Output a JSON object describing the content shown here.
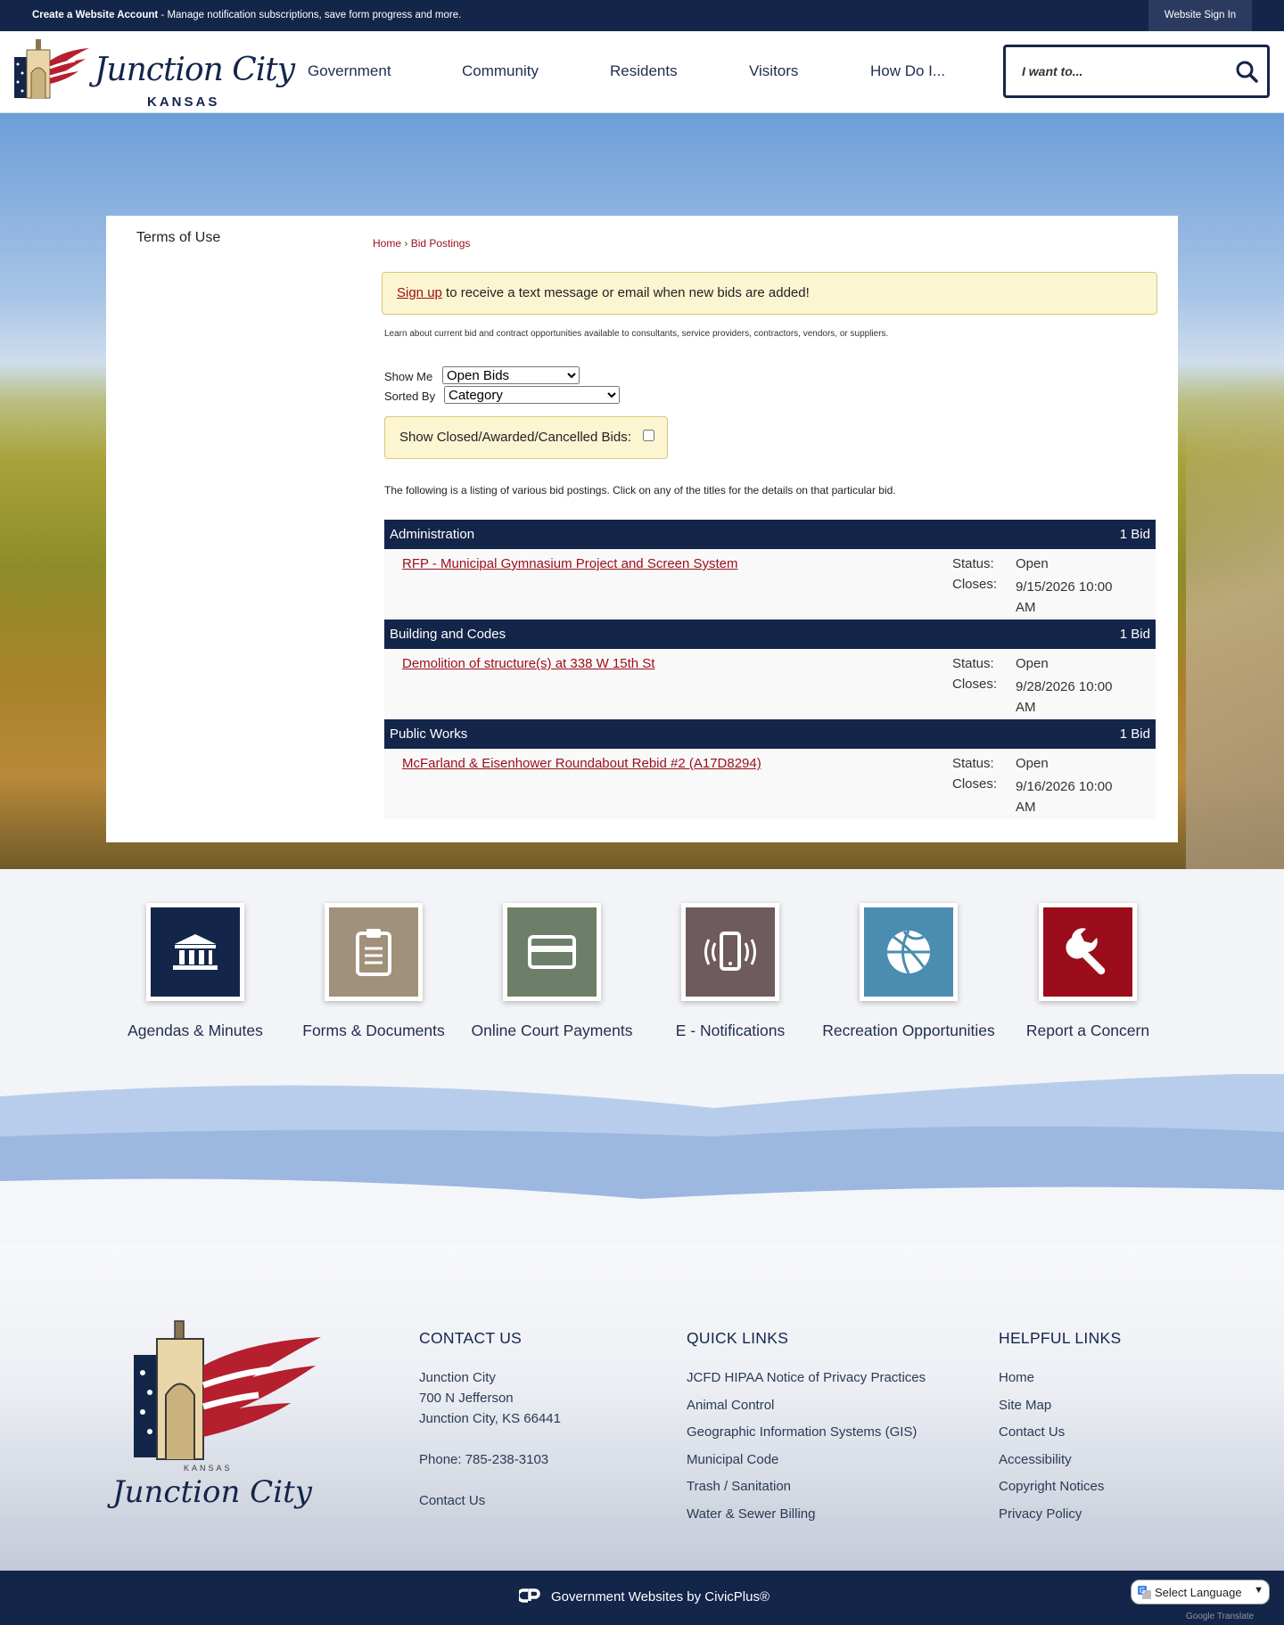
{
  "topbar": {
    "create_account": "Create a Website Account",
    "message": " - Manage notification subscriptions, save form progress and more.",
    "sign_in": "Website Sign In"
  },
  "header": {
    "logo_text": "Junction City",
    "logo_sub": "KANSAS",
    "nav": [
      "Government",
      "Community",
      "Residents",
      "Visitors",
      "How Do I..."
    ],
    "search_placeholder": "I want to...",
    "search_icon": "search-icon"
  },
  "sidebar": {
    "link": "Terms of Use"
  },
  "breadcrumb": {
    "home": "Home",
    "separator": " › ",
    "current": "Bid Postings"
  },
  "alert": {
    "link": "Sign up",
    "text": " to receive a text message or email when new bids are added!"
  },
  "intro": "Learn about current bid and contract opportunities available to consultants, service providers, contractors, vendors, or suppliers.",
  "filters": {
    "show_label": "Show Me",
    "show_value": "Open Bids",
    "sort_label": "Sorted By",
    "sort_value": "Category",
    "closed_label": "Show Closed/Awarded/Cancelled Bids:"
  },
  "listing_text": "The following is a listing of various bid postings. Click on any of the titles for the details on that particular bid.",
  "categories": [
    {
      "name": "Administration",
      "count": "1 Bid",
      "bid": {
        "title": "RFP - Municipal Gymnasium Project and Screen System",
        "status_label": "Status:",
        "status": "Open",
        "closes_label": "Closes:",
        "closes": "9/15/2026 10:00 AM"
      }
    },
    {
      "name": "Building and Codes",
      "count": "1 Bid",
      "bid": {
        "title": "Demolition of structure(s) at 338 W 15th St",
        "status_label": "Status:",
        "status": "Open",
        "closes_label": "Closes:",
        "closes": "9/28/2026 10:00 AM"
      }
    },
    {
      "name": "Public Works",
      "count": "1 Bid",
      "bid": {
        "title": "McFarland & Eisenhower Roundabout Rebid #2 (A17D8294)",
        "status_label": "Status:",
        "status": "Open",
        "closes_label": "Closes:",
        "closes": "9/16/2026 10:00 AM"
      }
    }
  ],
  "quick_links": [
    {
      "label": "Agendas & Minutes",
      "icon": "government-building-icon",
      "color": "#14254a"
    },
    {
      "label": "Forms & Documents",
      "icon": "clipboard-icon",
      "color": "#a1907a"
    },
    {
      "label": "Online Court Payments",
      "icon": "credit-card-icon",
      "color": "#6d7e69"
    },
    {
      "label": "E - Notifications",
      "icon": "phone-vibrate-icon",
      "color": "#6f5a5d"
    },
    {
      "label": "Recreation Opportunities",
      "icon": "basketball-icon",
      "color": "#4b8db0"
    },
    {
      "label": "Report a Concern",
      "icon": "wrench-icon",
      "color": "#9b0d1a"
    }
  ],
  "footer": {
    "contact": {
      "heading": "CONTACT US",
      "name": "Junction City",
      "street": "700 N Jefferson",
      "city": "Junction City, KS 66441",
      "phone": "Phone: 785-238-3103",
      "link": "Contact Us"
    },
    "quick": {
      "heading": "QUICK LINKS",
      "items": [
        "JCFD HIPAA Notice of Privacy Practices",
        "Animal Control",
        "Geographic Information Systems (GIS)",
        "Municipal Code",
        "Trash / Sanitation",
        "Water & Sewer Billing"
      ]
    },
    "helpful": {
      "heading": "HELPFUL LINKS",
      "items": [
        "Home",
        "Site Map",
        "Contact Us",
        "Accessibility",
        "Copyright Notices",
        "Privacy Policy"
      ]
    },
    "logo_kansas": "KANSAS",
    "logo_script": "Junction City"
  },
  "bottom": {
    "civicplus": "Government Websites by CivicPlus®",
    "language": "Select Language",
    "google_translate": "Google Translate"
  },
  "colors": {
    "navy": "#14254a",
    "link_red": "#9b0d1a",
    "alert_bg": "#fbf5d2"
  }
}
